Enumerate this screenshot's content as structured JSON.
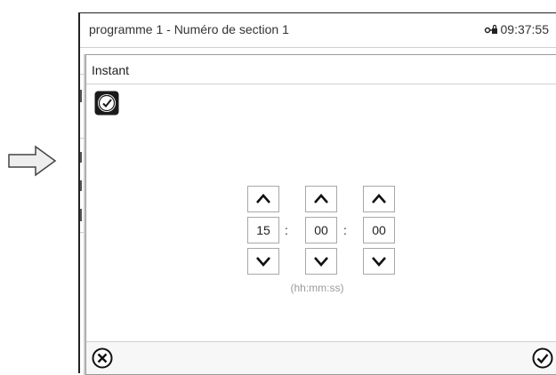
{
  "status_bar": {
    "title": "programme 1 - Numéro de section 1",
    "time": "09:37:55",
    "lock_icon": "lock-key-icon"
  },
  "dialog": {
    "title": "Instant",
    "clock_icon": "clock-icon",
    "fields": [
      {
        "name": "hours",
        "value": "15"
      },
      {
        "name": "minutes",
        "value": "00"
      },
      {
        "name": "seconds",
        "value": "00"
      }
    ],
    "separator": ":",
    "format_hint": "(hh:mm:ss)",
    "cancel_icon": "cancel-circle-icon",
    "confirm_icon": "confirm-check-icon"
  }
}
